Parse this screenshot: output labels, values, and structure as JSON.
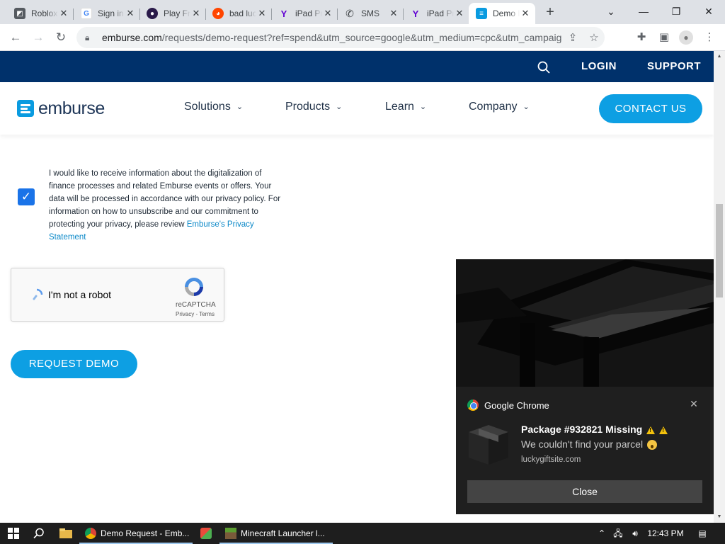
{
  "browser": {
    "tabs": [
      {
        "title": "Roblox",
        "icon": "roblox-icon",
        "color": "#555a60"
      },
      {
        "title": "Sign in",
        "icon": "google-icon",
        "color": "#4285f4"
      },
      {
        "title": "Play Free",
        "icon": "play-icon",
        "color": "#2a1a4a"
      },
      {
        "title": "bad luck",
        "icon": "reddit-icon",
        "color": "#ff4500"
      },
      {
        "title": "iPad Pro",
        "icon": "yahoo-icon",
        "color": "#6001d2"
      },
      {
        "title": "SMS",
        "icon": "phone-icon",
        "color": "#3c4043"
      },
      {
        "title": "iPad Pro",
        "icon": "yahoo-icon",
        "color": "#6001d2"
      },
      {
        "title": "Demo Request",
        "icon": "emburse-icon",
        "color": "#0a9be0"
      }
    ],
    "url_domain": "emburse.com",
    "url_rest": "/requests/demo-request?ref=spend&utm_source=google&utm_medium=cpc&utm_campaign=..."
  },
  "topbar": {
    "login": "LOGIN",
    "support": "SUPPORT"
  },
  "nav": {
    "logo": "emburse",
    "links": [
      "Solutions",
      "Products",
      "Learn",
      "Company"
    ],
    "contact": "CONTACT US"
  },
  "consent": {
    "text": "I would like to receive information about the digitalization of finance processes and related Emburse events or offers. Your data will be processed in accordance with our privacy policy. For information on how to unsubscribe and our commitment to protecting your privacy, please review ",
    "link": "Emburse's Privacy Statement",
    "checked": true
  },
  "recaptcha": {
    "label": "I'm not a robot",
    "brand": "reCAPTCHA",
    "terms": "Privacy - Terms"
  },
  "form": {
    "submit": "REQUEST DEMO"
  },
  "notification": {
    "app": "Google Chrome",
    "title": "Package #932821 Missing",
    "body": "We couldn't find your parcel",
    "site": "luckygiftsite.com",
    "button": "Close"
  },
  "taskbar": {
    "apps": [
      {
        "label": "Demo Request - Emb...",
        "icon": "chrome-icon"
      },
      {
        "label": "",
        "icon": "app-icon"
      },
      {
        "label": "Minecraft Launcher l...",
        "icon": "minecraft-icon"
      }
    ],
    "time": "12:43 PM"
  },
  "colors": {
    "brand_navy": "#00316b",
    "brand_blue": "#0d9fe3"
  }
}
